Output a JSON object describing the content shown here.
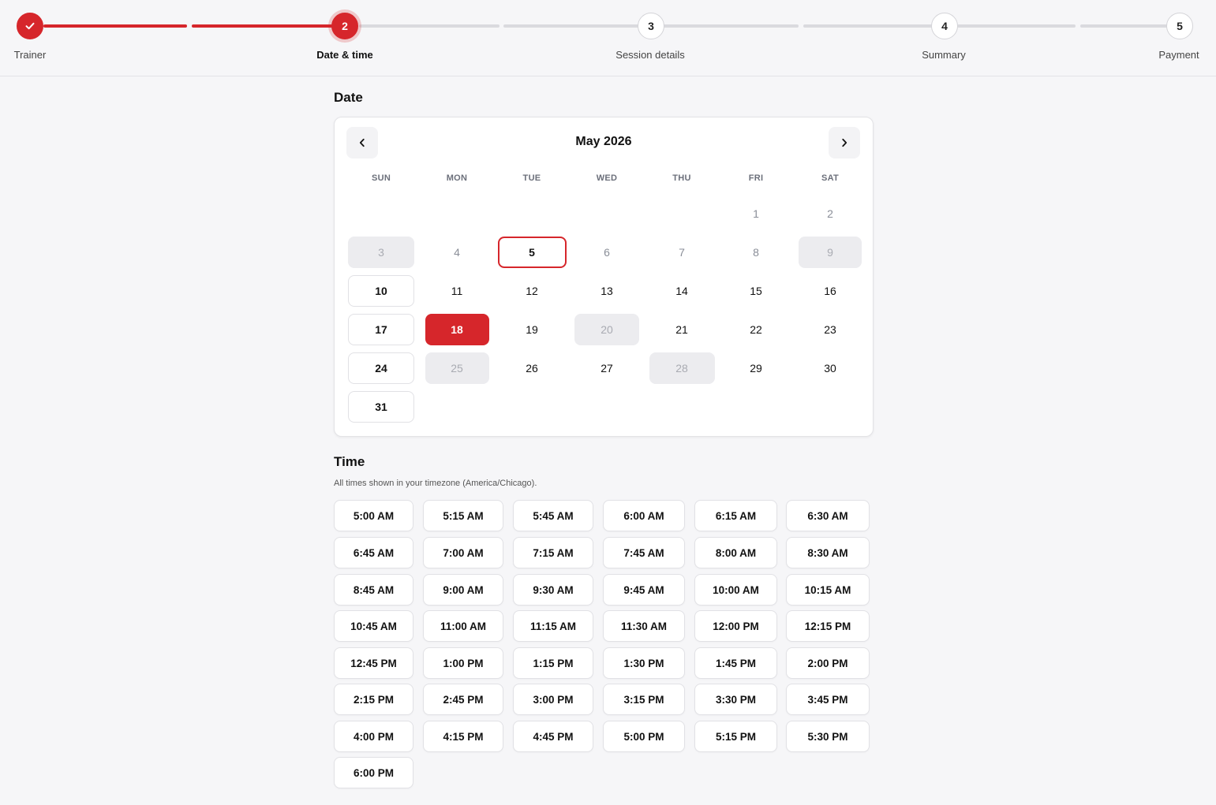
{
  "stepper": {
    "steps": [
      {
        "number": "1",
        "label": "Trainer",
        "state": "complete"
      },
      {
        "number": "2",
        "label": "Date & time",
        "state": "active"
      },
      {
        "number": "3",
        "label": "Session details",
        "state": "upcoming"
      },
      {
        "number": "4",
        "label": "Summary",
        "state": "upcoming"
      },
      {
        "number": "5",
        "label": "Payment",
        "state": "upcoming"
      }
    ]
  },
  "date_section": {
    "title": "Date",
    "month_label": "May 2026",
    "prev_icon": "chevron-left-icon",
    "next_icon": "chevron-right-icon",
    "weekdays": [
      "SUN",
      "MON",
      "TUE",
      "WED",
      "THU",
      "FRI",
      "SAT"
    ],
    "weeks": [
      [
        null,
        null,
        null,
        null,
        null,
        {
          "d": "1",
          "s": "muted"
        },
        {
          "d": "2",
          "s": "muted"
        }
      ],
      [
        {
          "d": "3",
          "s": "disabled"
        },
        {
          "d": "4",
          "s": "muted"
        },
        {
          "d": "5",
          "s": "today"
        },
        {
          "d": "6",
          "s": "muted"
        },
        {
          "d": "7",
          "s": "muted"
        },
        {
          "d": "8",
          "s": "muted"
        },
        {
          "d": "9",
          "s": "disabled"
        }
      ],
      [
        {
          "d": "10",
          "s": "outlined"
        },
        {
          "d": "11",
          "s": "normal"
        },
        {
          "d": "12",
          "s": "normal"
        },
        {
          "d": "13",
          "s": "normal"
        },
        {
          "d": "14",
          "s": "normal"
        },
        {
          "d": "15",
          "s": "normal"
        },
        {
          "d": "16",
          "s": "normal"
        }
      ],
      [
        {
          "d": "17",
          "s": "outlined"
        },
        {
          "d": "18",
          "s": "selected"
        },
        {
          "d": "19",
          "s": "normal"
        },
        {
          "d": "20",
          "s": "disabled"
        },
        {
          "d": "21",
          "s": "normal"
        },
        {
          "d": "22",
          "s": "normal"
        },
        {
          "d": "23",
          "s": "normal"
        }
      ],
      [
        {
          "d": "24",
          "s": "outlined"
        },
        {
          "d": "25",
          "s": "disabled"
        },
        {
          "d": "26",
          "s": "normal"
        },
        {
          "d": "27",
          "s": "normal"
        },
        {
          "d": "28",
          "s": "disabled"
        },
        {
          "d": "29",
          "s": "normal"
        },
        {
          "d": "30",
          "s": "normal"
        }
      ],
      [
        {
          "d": "31",
          "s": "outlined"
        },
        null,
        null,
        null,
        null,
        null,
        null
      ]
    ]
  },
  "time_section": {
    "title": "Time",
    "timezone_note": "All times shown in your timezone (America/Chicago).",
    "slots": [
      "5:00 AM",
      "5:15 AM",
      "5:45 AM",
      "6:00 AM",
      "6:15 AM",
      "6:30 AM",
      "6:45 AM",
      "7:00 AM",
      "7:15 AM",
      "7:45 AM",
      "8:00 AM",
      "8:30 AM",
      "8:45 AM",
      "9:00 AM",
      "9:30 AM",
      "9:45 AM",
      "10:00 AM",
      "10:15 AM",
      "10:45 AM",
      "11:00 AM",
      "11:15 AM",
      "11:30 AM",
      "12:00 PM",
      "12:15 PM",
      "12:45 PM",
      "1:00 PM",
      "1:15 PM",
      "1:30 PM",
      "1:45 PM",
      "2:00 PM",
      "2:15 PM",
      "2:45 PM",
      "3:00 PM",
      "3:15 PM",
      "3:30 PM",
      "3:45 PM",
      "4:00 PM",
      "4:15 PM",
      "4:45 PM",
      "5:00 PM",
      "5:15 PM",
      "5:30 PM",
      "6:00 PM"
    ]
  },
  "colors": {
    "accent": "#d6262b",
    "background": "#f6f6f8",
    "disabled_cell": "#ececef"
  }
}
